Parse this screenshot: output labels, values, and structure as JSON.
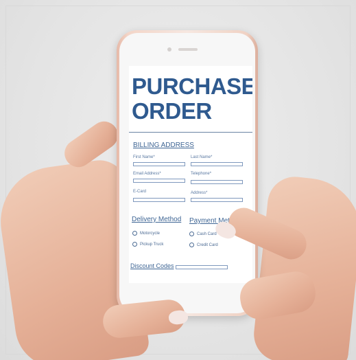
{
  "screen": {
    "title_line1": "PURCHASE",
    "title_line2": "ORDER",
    "billing": {
      "heading": "BILLING ADDRESS",
      "fields": [
        {
          "label": "First Name*"
        },
        {
          "label": "Last Name*"
        },
        {
          "label": "Email Address*"
        },
        {
          "label": "Telephone*"
        },
        {
          "label": "E-Card"
        },
        {
          "label": "Address*"
        }
      ]
    },
    "delivery": {
      "heading": "Delivery Method",
      "options": [
        "Motorcycle",
        "Pickup Truck"
      ]
    },
    "payment": {
      "heading": "Payment Method",
      "options": [
        "Cash Card",
        "Credit Card"
      ]
    },
    "discount": {
      "label": "Discount Codes"
    }
  }
}
